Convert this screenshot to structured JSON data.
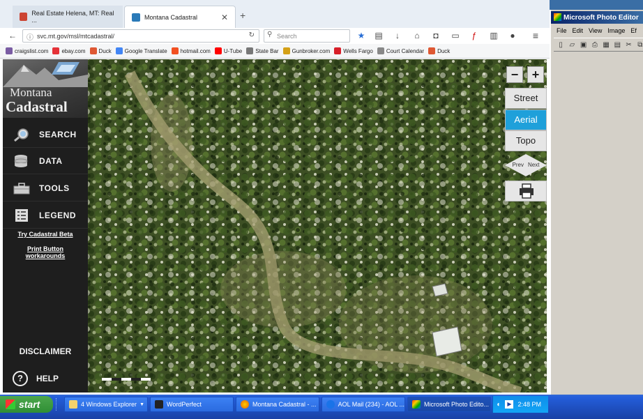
{
  "browser": {
    "tabs": [
      {
        "label": "Real Estate Helena, MT: Real ...",
        "active": false
      },
      {
        "label": "Montana Cadastral",
        "active": true
      }
    ],
    "url": "svc.mt.gov/msl/mtcadastral/",
    "search_placeholder": "Search",
    "bookmarks": [
      {
        "label": "craigslist.com",
        "color": "#7a5ca3"
      },
      {
        "label": "ebay.com",
        "color": "#e53238"
      },
      {
        "label": "Duck",
        "color": "#de5833"
      },
      {
        "label": "Google Translate",
        "color": "#4285f4"
      },
      {
        "label": "hotmail.com",
        "color": "#f25022"
      },
      {
        "label": "U-Tube",
        "color": "#ff0000"
      },
      {
        "label": "State Bar",
        "color": "#777777"
      },
      {
        "label": "Gunbroker.com",
        "color": "#d4a017"
      },
      {
        "label": "Wells Fargo",
        "color": "#d71e28"
      },
      {
        "label": "Court Calendar",
        "color": "#888888"
      },
      {
        "label": "Duck",
        "color": "#de5833"
      }
    ]
  },
  "app": {
    "logo_line1": "Montana",
    "logo_line2": "Cadastral",
    "menu": [
      {
        "label": "SEARCH",
        "icon": "search-icon"
      },
      {
        "label": "DATA",
        "icon": "database-icon"
      },
      {
        "label": "TOOLS",
        "icon": "toolbox-icon"
      },
      {
        "label": "LEGEND",
        "icon": "legend-icon"
      }
    ],
    "link_beta": "Try Cadastral Beta",
    "link_print_1": "Print Button",
    "link_print_2": "workarounds",
    "disclaimer": "DISCLAIMER",
    "help": "HELP",
    "map_controls": {
      "zoom_out": "−",
      "zoom_in": "+",
      "street": "Street",
      "aerial": "Aerial",
      "topo": "Topo",
      "prev": "Prev",
      "next": "Next"
    }
  },
  "photo_editor": {
    "title": "Microsoft Photo Editor",
    "menu": [
      "File",
      "Edit",
      "View",
      "Image",
      "Ef"
    ]
  },
  "taskbar": {
    "start": "start",
    "items": [
      {
        "label": "4 Windows Explorer",
        "active": false
      },
      {
        "label": "WordPerfect",
        "active": false
      },
      {
        "label": "Montana Cadastral - ...",
        "active": false
      },
      {
        "label": "AOL Mail (234) - AOL ...",
        "active": false
      },
      {
        "label": "Microsoft Photo Edito...",
        "active": true
      }
    ],
    "clock": "2:48 PM"
  }
}
